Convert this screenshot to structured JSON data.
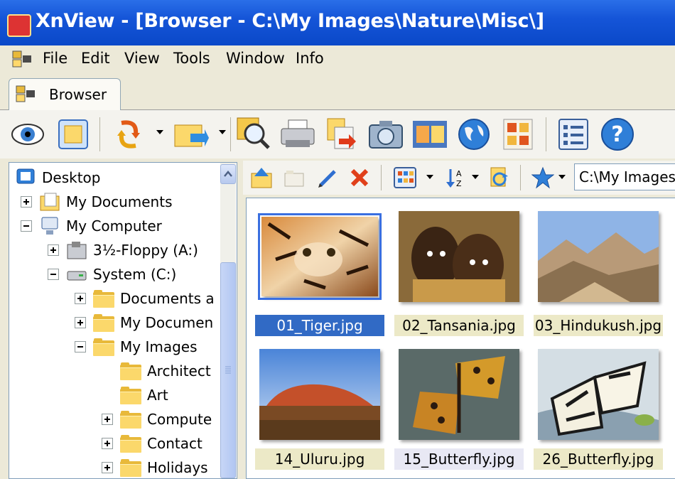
{
  "window": {
    "title": "XnView - [Browser - C:\\My Images\\Nature\\Misc\\]"
  },
  "menu": [
    "File",
    "Edit",
    "View",
    "Tools",
    "Window",
    "Info"
  ],
  "tabs": [
    {
      "label": "Browser"
    }
  ],
  "toolbar": {
    "icons": [
      "view-eye-icon",
      "fullscreen-icon",
      "rotate-icon",
      "file-operations-icon",
      "search-icon",
      "print-icon",
      "export-icon",
      "capture-icon",
      "filmstrip-icon",
      "web-globe-icon",
      "contact-sheet-icon",
      "properties-icon",
      "help-icon"
    ]
  },
  "browser_toolbar": {
    "path": "C:\\My Images"
  },
  "tree": [
    {
      "label": "Desktop",
      "icon": "desktop-icon",
      "level": 0,
      "expander": "none"
    },
    {
      "label": "My Documents",
      "icon": "my-documents-icon",
      "level": 1,
      "expander": "plus"
    },
    {
      "label": "My Computer",
      "icon": "computer-icon",
      "level": 1,
      "expander": "minus"
    },
    {
      "label": "3½-Floppy (A:)",
      "icon": "floppy-icon",
      "level": 2,
      "expander": "plus"
    },
    {
      "label": "System (C:)",
      "icon": "drive-icon",
      "level": 2,
      "expander": "minus"
    },
    {
      "label": "Documents a",
      "icon": "folder-icon",
      "level": 3,
      "expander": "plus"
    },
    {
      "label": "My Documen",
      "icon": "folder-icon",
      "level": 3,
      "expander": "plus"
    },
    {
      "label": "My Images",
      "icon": "folder-icon",
      "level": 3,
      "expander": "minus"
    },
    {
      "label": "Architect",
      "icon": "folder-icon",
      "level": 4,
      "expander": "none"
    },
    {
      "label": "Art",
      "icon": "folder-icon",
      "level": 4,
      "expander": "none"
    },
    {
      "label": "Compute",
      "icon": "folder-icon",
      "level": 4,
      "expander": "plus"
    },
    {
      "label": "Contact",
      "icon": "folder-icon",
      "level": 4,
      "expander": "plus"
    },
    {
      "label": "Holidays",
      "icon": "folder-icon",
      "level": 4,
      "expander": "plus"
    }
  ],
  "thumbnails": [
    {
      "name": "01_Tiger.jpg",
      "selected": true
    },
    {
      "name": "02_Tansania.jpg",
      "selected": false
    },
    {
      "name": "03_Hindukush.jpg",
      "selected": false
    },
    {
      "name": "14_Uluru.jpg",
      "selected": false
    },
    {
      "name": "15_Butterfly.jpg",
      "selected": false
    },
    {
      "name": "26_Butterfly.jpg",
      "selected": false
    }
  ],
  "colors": {
    "titlebar": "#0a48c8",
    "selection": "#316ac5",
    "caption_bg": "#ece9c7"
  }
}
